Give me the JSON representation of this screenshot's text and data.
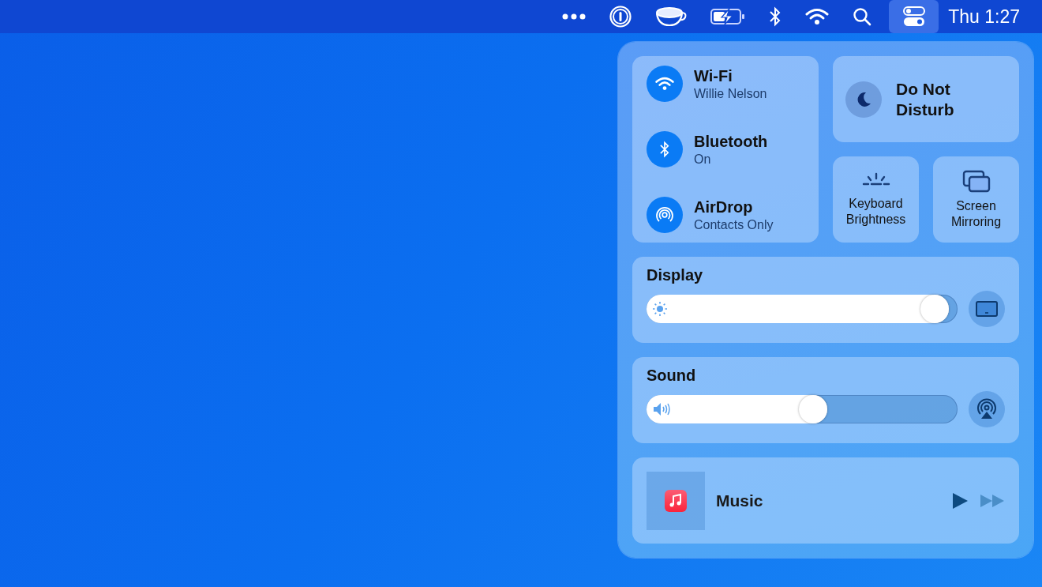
{
  "menu_bar": {
    "clock": "Thu 1:27",
    "control_center_selected": true
  },
  "control_center": {
    "connectivity": [
      {
        "kind": "wifi",
        "name": "Wi-Fi",
        "status": "Willie Nelson",
        "on": true
      },
      {
        "kind": "bluetooth",
        "name": "Bluetooth",
        "status": "On",
        "on": true
      },
      {
        "kind": "airdrop",
        "name": "AirDrop",
        "status": "Contacts Only",
        "on": true
      }
    ],
    "do_not_disturb": {
      "label": "Do Not Disturb",
      "on": false
    },
    "tiles": [
      {
        "kind": "keyboard_brightness",
        "label": "Keyboard Brightness"
      },
      {
        "kind": "screen_mirroring",
        "label": "Screen Mirroring"
      }
    ],
    "sliders": [
      {
        "kind": "display",
        "title": "Display",
        "level": 0.97
      },
      {
        "kind": "sound",
        "title": "Sound",
        "level": 0.54
      }
    ],
    "now_playing": {
      "app": "Music",
      "playing": false
    }
  }
}
